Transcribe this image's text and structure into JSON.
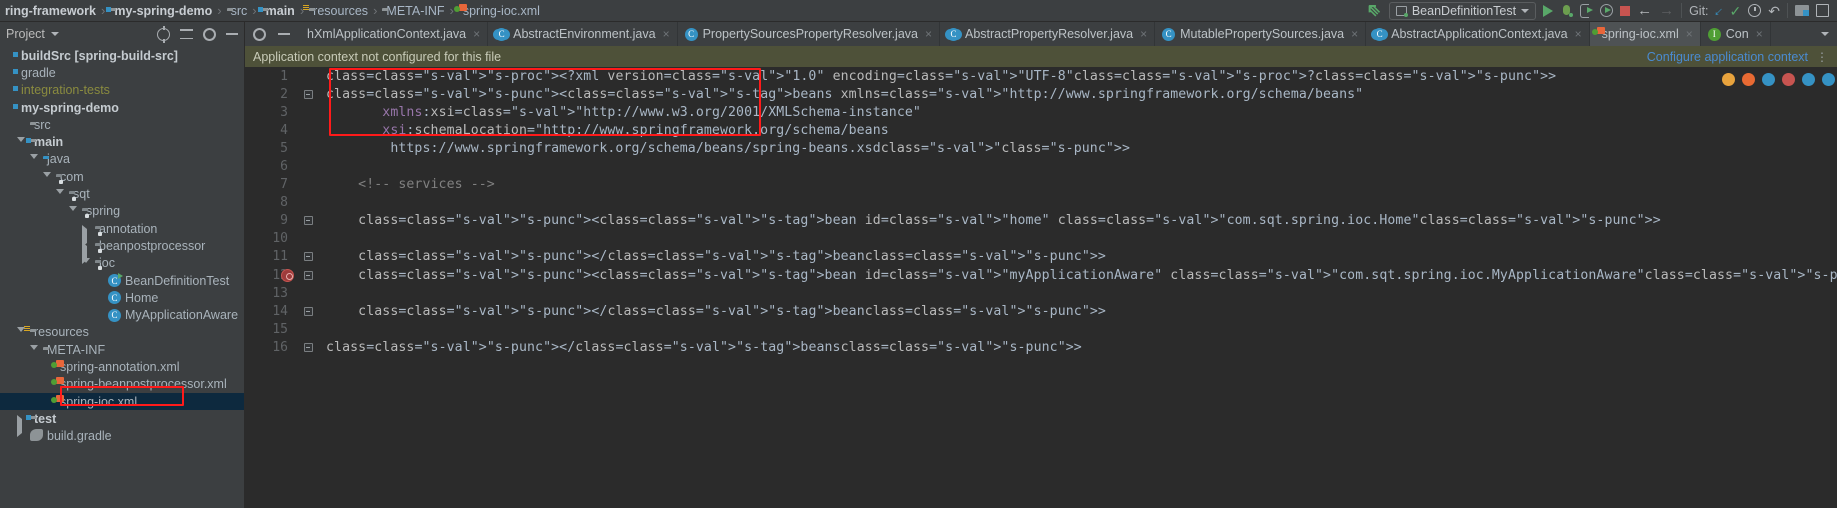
{
  "navbar": {
    "breadcrumbs": [
      {
        "label": "ring-framework",
        "icon": "none",
        "bold": true
      },
      {
        "label": "my-spring-demo",
        "icon": "module-folder-icon",
        "bold": true
      },
      {
        "label": "src",
        "icon": "folder-icon",
        "bold": false
      },
      {
        "label": "main",
        "icon": "module-folder-icon",
        "bold": true
      },
      {
        "label": "resources",
        "icon": "resources-folder-icon",
        "bold": false
      },
      {
        "label": "META-INF",
        "icon": "folder-icon",
        "bold": false
      },
      {
        "label": "spring-ioc.xml",
        "icon": "xml-file-icon",
        "bold": false
      }
    ],
    "run_configuration": "BeanDefinitionTest",
    "git_label": "Git:",
    "actions": [
      "back-arrow-icon",
      "run-button",
      "debug-button",
      "run-with-profiler-button",
      "run-with-coverage-button",
      "stop-button",
      "navigate-back-button",
      "navigate-forward-button",
      "git-update-button",
      "git-commit-button",
      "git-history-button",
      "git-rollback-button",
      "project-structure-button",
      "search-everywhere-button"
    ]
  },
  "sidebar": {
    "title": "Project",
    "tools": [
      "select-opened-file-icon",
      "collapse-all-icon",
      "settings-icon",
      "hide-icon"
    ],
    "tree": [
      {
        "label": "buildSrc [spring-build-src]",
        "depth": 0,
        "twisty": "none",
        "icon": "module-icon",
        "style": "bold"
      },
      {
        "label": "gradle",
        "depth": 0,
        "twisty": "none",
        "icon": "module-icon",
        "style": "normal"
      },
      {
        "label": "integration-tests",
        "depth": 0,
        "twisty": "none",
        "icon": "module-icon",
        "style": "olive"
      },
      {
        "label": "my-spring-demo",
        "depth": 0,
        "twisty": "none",
        "icon": "module-icon",
        "style": "bold"
      },
      {
        "label": "src",
        "depth": 1,
        "twisty": "none",
        "icon": "folder-icon",
        "style": "normal"
      },
      {
        "label": "main",
        "depth": 1,
        "twisty": "down",
        "icon": "module-folder-icon",
        "style": "bold"
      },
      {
        "label": "java",
        "depth": 2,
        "twisty": "down",
        "icon": "source-folder-icon",
        "style": "normal"
      },
      {
        "label": "com",
        "depth": 3,
        "twisty": "down",
        "icon": "package-icon",
        "style": "normal"
      },
      {
        "label": "sqt",
        "depth": 4,
        "twisty": "down",
        "icon": "package-icon",
        "style": "normal"
      },
      {
        "label": "spring",
        "depth": 5,
        "twisty": "down",
        "icon": "package-icon",
        "style": "normal"
      },
      {
        "label": "annotation",
        "depth": 6,
        "twisty": "right",
        "icon": "package-icon",
        "style": "normal"
      },
      {
        "label": "beanpostprocessor",
        "depth": 6,
        "twisty": "right",
        "icon": "package-icon",
        "style": "normal"
      },
      {
        "label": "ioc",
        "depth": 6,
        "twisty": "down",
        "icon": "package-icon",
        "style": "normal"
      },
      {
        "label": "BeanDefinitionTest",
        "depth": 7,
        "twisty": "none",
        "icon": "java-class-runnable-icon",
        "style": "normal"
      },
      {
        "label": "Home",
        "depth": 7,
        "twisty": "none",
        "icon": "java-class-icon",
        "style": "normal"
      },
      {
        "label": "MyApplicationAware",
        "depth": 7,
        "twisty": "none",
        "icon": "java-class-icon",
        "style": "normal"
      },
      {
        "label": "resources",
        "depth": 1,
        "twisty": "down",
        "icon": "resources-folder-icon",
        "style": "normal"
      },
      {
        "label": "META-INF",
        "depth": 2,
        "twisty": "down",
        "icon": "folder-icon",
        "style": "normal"
      },
      {
        "label": "spring-annotation.xml",
        "depth": 3,
        "twisty": "none",
        "icon": "xml-file-icon",
        "style": "normal"
      },
      {
        "label": "spring-beanpostprocessor.xml",
        "depth": 3,
        "twisty": "none",
        "icon": "xml-file-icon",
        "style": "normal"
      },
      {
        "label": "spring-ioc.xml",
        "depth": 3,
        "twisty": "none",
        "icon": "xml-file-icon",
        "style": "normal",
        "selected": true,
        "highlighted": true
      },
      {
        "label": "test",
        "depth": 1,
        "twisty": "right",
        "icon": "module-folder-icon",
        "style": "bold"
      },
      {
        "label": "build.gradle",
        "depth": 1,
        "twisty": "none",
        "icon": "gradle-file-icon",
        "style": "normal"
      }
    ]
  },
  "tabs": {
    "controls": [
      "settings-icon",
      "hide-icon"
    ],
    "items": [
      {
        "label": "hXmlApplicationContext.java",
        "icon": "java-class-icon",
        "active": false,
        "truncated": true
      },
      {
        "label": "AbstractEnvironment.java",
        "icon": "java-abstract-class-icon",
        "active": false
      },
      {
        "label": "PropertySourcesPropertyResolver.java",
        "icon": "java-class-icon",
        "active": false
      },
      {
        "label": "AbstractPropertyResolver.java",
        "icon": "java-abstract-class-icon",
        "active": false
      },
      {
        "label": "MutablePropertySources.java",
        "icon": "java-class-icon",
        "active": false
      },
      {
        "label": "AbstractApplicationContext.java",
        "icon": "java-abstract-class-icon",
        "active": false
      },
      {
        "label": "spring-ioc.xml",
        "icon": "xml-file-icon",
        "active": true
      },
      {
        "label": "Con",
        "icon": "junit-icon",
        "active": false,
        "truncated": true
      }
    ]
  },
  "notification": {
    "message": "Application context not configured for this file",
    "link": "Configure application context",
    "more": "⋮"
  },
  "editor": {
    "file": "spring-ioc.xml",
    "lines": [
      {
        "num": 1,
        "fold": "none",
        "breakpoint": false
      },
      {
        "num": 2,
        "fold": "collapse",
        "breakpoint": false
      },
      {
        "num": 3,
        "fold": "none",
        "breakpoint": false
      },
      {
        "num": 4,
        "fold": "none",
        "breakpoint": false
      },
      {
        "num": 5,
        "fold": "none",
        "breakpoint": false
      },
      {
        "num": 6,
        "fold": "none",
        "breakpoint": false
      },
      {
        "num": 7,
        "fold": "none",
        "breakpoint": false
      },
      {
        "num": 8,
        "fold": "none",
        "breakpoint": false
      },
      {
        "num": 9,
        "fold": "collapse",
        "breakpoint": false
      },
      {
        "num": 10,
        "fold": "none",
        "breakpoint": false
      },
      {
        "num": 11,
        "fold": "collapse-end",
        "breakpoint": false
      },
      {
        "num": 12,
        "fold": "collapse",
        "breakpoint": true
      },
      {
        "num": 13,
        "fold": "none",
        "breakpoint": false
      },
      {
        "num": 14,
        "fold": "collapse-end",
        "breakpoint": false
      },
      {
        "num": 15,
        "fold": "none",
        "breakpoint": false
      },
      {
        "num": 16,
        "fold": "collapse-end",
        "breakpoint": false
      }
    ],
    "code_text": [
      "<?xml version=\"1.0\" encoding=\"UTF-8\"?>",
      "<beans xmlns=\"http://www.springframework.org/schema/beans\"",
      "       xmlns:xsi=\"http://www.w3.org/2001/XMLSchema-instance\"",
      "       xsi:schemaLocation=\"http://www.springframework.org/schema/beans",
      "        https://www.springframework.org/schema/beans/spring-beans.xsd\">",
      "",
      "    <!-- services -->",
      "",
      "    <bean id=\"home\" class=\"com.sqt.spring.ioc.Home\">",
      "",
      "    </bean>",
      "    <bean id=\"myApplicationAware\" class=\"com.sqt.spring.ioc.MyApplicationAware\">",
      "",
      "    </bean>",
      "",
      "</beans>"
    ],
    "markers": [
      {
        "name": "inspection-marker-1",
        "color": "#e8a33d"
      },
      {
        "name": "inspection-marker-2",
        "color": "#e86a33"
      },
      {
        "name": "inspection-marker-3",
        "color": "#3592c4"
      },
      {
        "name": "inspection-marker-4",
        "color": "#c75450"
      },
      {
        "name": "inspection-marker-5",
        "color": "#3592c4"
      },
      {
        "name": "inspection-marker-6",
        "color": "#3592c4"
      }
    ],
    "annotations": [
      {
        "name": "code-highlight-box",
        "color": "#ff1a1a"
      },
      {
        "name": "sidebar-file-highlight-box",
        "color": "#ff1a1a"
      }
    ]
  }
}
